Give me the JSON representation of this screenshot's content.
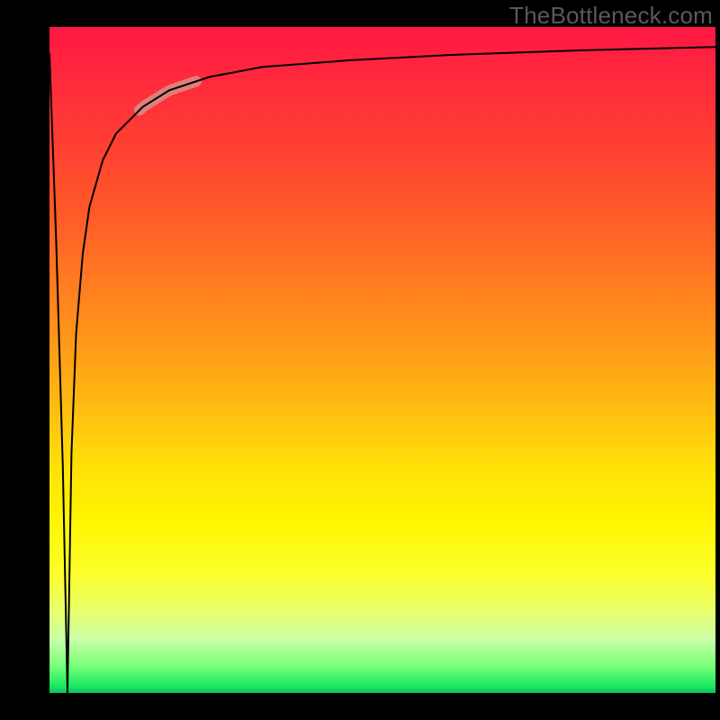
{
  "watermark": "TheBottleneck.com",
  "colors": {
    "background": "#000000",
    "watermark_text": "#595959",
    "curve": "#000000",
    "highlight": "#d4938b",
    "gradient_stops": [
      "#ff1744",
      "#ff7a20",
      "#fff500",
      "#78ff78",
      "#0fbf60"
    ]
  },
  "chart_data": {
    "type": "line",
    "title": "",
    "xlabel": "",
    "ylabel": "",
    "xlim": [
      0,
      100
    ],
    "ylim": [
      0,
      100
    ],
    "description": "Bottleneck percentage curve. Y (top=high %, bottom=0%) vs an x-axis parameter. Curve starts at (0, ~96), drops straight down to (~2.7, 0), then rises rapidly along an asymptotic curve toward high-90s% as x increases, approaching ~97 at x=100. A highlighted segment marks roughly x in [14,22].",
    "x": [
      0,
      1,
      2,
      2.7,
      2.7,
      3.3,
      4,
      5,
      6,
      8,
      10,
      14,
      18,
      24,
      32,
      45,
      60,
      80,
      100
    ],
    "y": [
      96,
      68,
      34,
      0,
      0,
      36,
      54,
      66,
      73,
      80,
      84,
      88,
      90.5,
      92.5,
      94,
      95,
      95.8,
      96.5,
      97
    ],
    "highlight_range_x": [
      13.5,
      22
    ]
  }
}
